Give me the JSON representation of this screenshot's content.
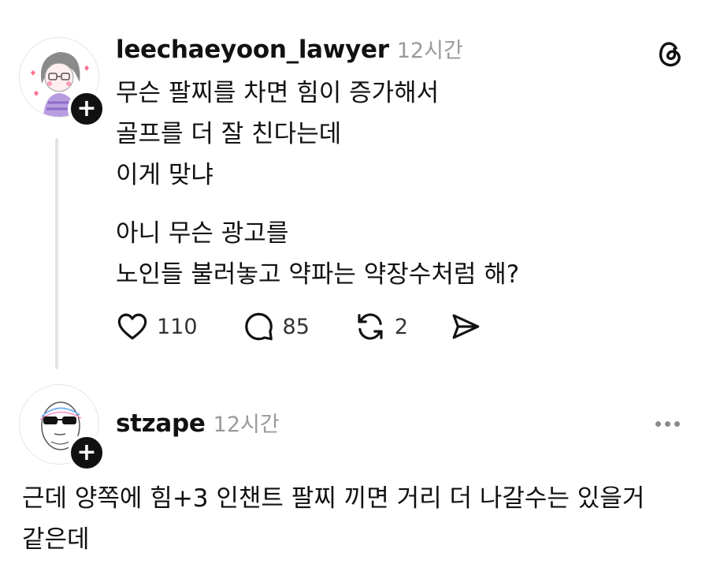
{
  "post": {
    "username": "leechaeyoon_lawyer",
    "time": "12시간",
    "paragraphs": [
      [
        "무슨 팔찌를 차면 힘이 증가해서",
        "골프를 더 잘 친다는데",
        "이게 맞냐"
      ],
      [
        "아니 무슨 광고를",
        "노인들 불러놓고 약파는 약장수처럼 해?"
      ]
    ],
    "actions": {
      "likes": "110",
      "replies": "85",
      "reposts": "2"
    },
    "avatar_icon": "illustrated-woman-avatar",
    "follow_icon": "+"
  },
  "reply": {
    "username": "stzape",
    "time": "12시간",
    "lines": [
      "근데 양쪽에 힘+3 인챈트 팔찌 끼면 거리 더 나갈수는 있을거",
      "같은데"
    ],
    "avatar_icon": "sunglasses-face-avatar",
    "follow_icon": "+"
  },
  "colors": {
    "text": "#111111",
    "muted": "#9a9a9a",
    "thread_line": "#e3e3e3"
  }
}
